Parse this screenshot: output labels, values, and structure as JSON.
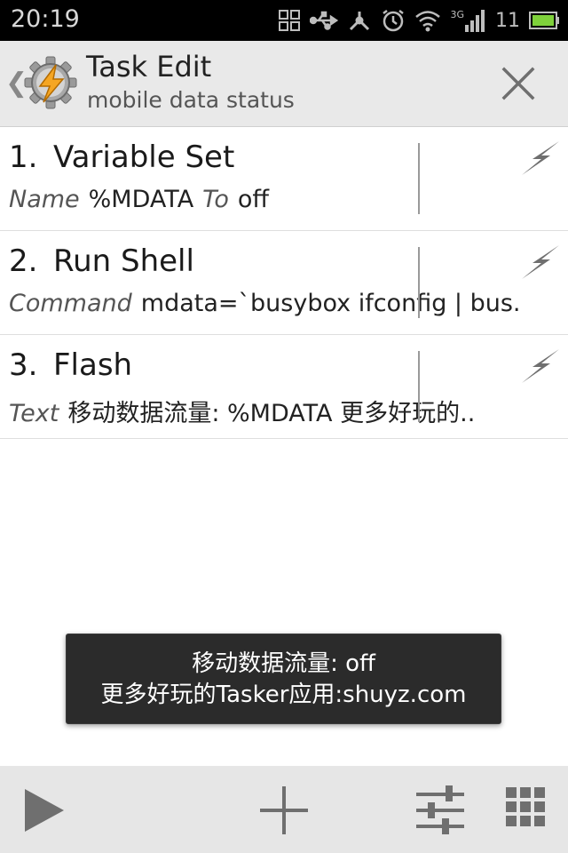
{
  "status_bar": {
    "time": "20:19",
    "network_label": "3G",
    "signal_extra": "11",
    "icons": [
      "grid-icon",
      "usb-icon",
      "usb-debug-icon",
      "alarm-icon",
      "wifi-icon",
      "signal-icon",
      "battery-icon"
    ]
  },
  "header": {
    "title": "Task Edit",
    "subtitle": "mobile data status",
    "back_glyph": "❮"
  },
  "actions": [
    {
      "number": "1.",
      "name": "Variable Set",
      "key": "Name",
      "value": "%MDATA",
      "key2": "To",
      "value2": "off"
    },
    {
      "number": "2.",
      "name": "Run Shell",
      "key": "Command",
      "value": "mdata=`busybox ifconfig | bus.."
    },
    {
      "number": "3.",
      "name": "Flash",
      "key": "Text",
      "value": "移动数据流量: %MDATA 更多好玩的.."
    }
  ],
  "toast": {
    "line1": "移动数据流量: off",
    "line2": "更多好玩的Tasker应用:shuyz.com"
  },
  "colors": {
    "action_bar_bg": "#e9e9e9",
    "status_bar_bg": "#000000",
    "toast_bg": "#2b2b2b",
    "bottom_bar_bg": "#e6e6e6",
    "icon_gray": "#6f6f6f"
  }
}
